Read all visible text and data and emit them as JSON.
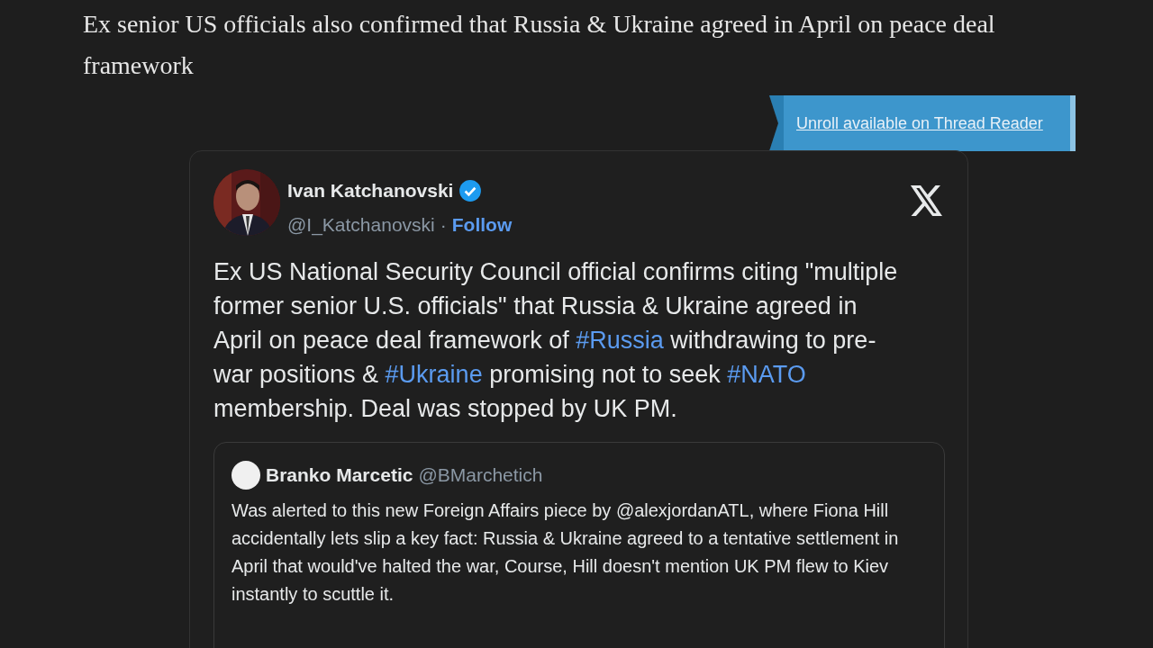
{
  "heading": "Ex senior US officials also confirmed that Russia & Ukraine agreed in April on peace deal framework",
  "unroll_link": "Unroll available on Thread Reader",
  "tweet": {
    "author": "Ivan Katchanovski",
    "verified": true,
    "handle": "@I_Katchanovski",
    "separator": "·",
    "follow": "Follow",
    "body": [
      {
        "kind": "text",
        "text": "Ex US National Security Council official confirms citing \"multiple former senior U.S. officials\" that Russia & Ukraine agreed in April on peace deal framework of "
      },
      {
        "kind": "hashtag",
        "text": "#Russia"
      },
      {
        "kind": "text",
        "text": " withdrawing to pre-war positions & "
      },
      {
        "kind": "hashtag",
        "text": "#Ukraine"
      },
      {
        "kind": "text",
        "text": " promising not to seek "
      },
      {
        "kind": "hashtag",
        "text": "#NATO"
      },
      {
        "kind": "text",
        "text": " membership. Deal was stopped by UK PM."
      }
    ],
    "quote": {
      "author": "Branko Marcetic",
      "handle": "@BMarchetich",
      "text": "Was alerted to this new Foreign Affairs piece by @alexjordanATL, where Fiona Hill accidentally lets slip a key fact: Russia & Ukraine agreed to a tentative settlement in April that would've halted the war, Course, Hill doesn't mention UK PM flew to Kiev instantly to scuttle it."
    }
  }
}
